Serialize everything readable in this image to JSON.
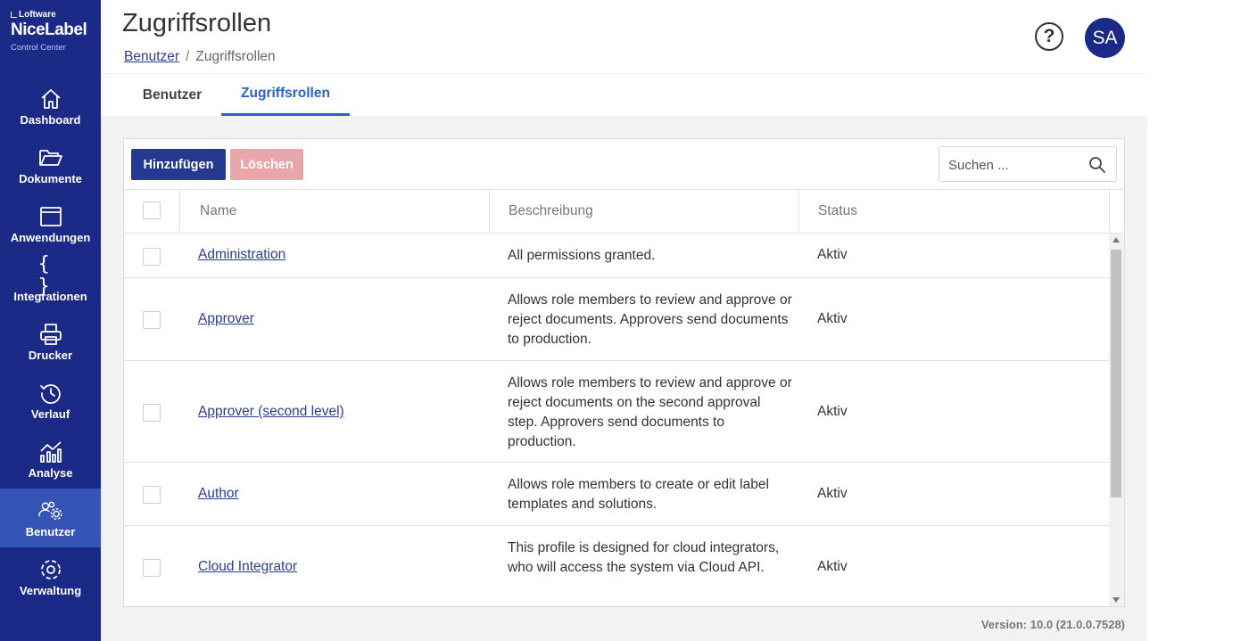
{
  "brand": {
    "company": "Loftware",
    "product": "NiceLabel",
    "subtitle": "Control Center"
  },
  "sidebar": {
    "items": [
      {
        "label": "Dashboard",
        "icon": "home-icon"
      },
      {
        "label": "Dokumente",
        "icon": "folder-icon"
      },
      {
        "label": "Anwendungen",
        "icon": "window-icon"
      },
      {
        "label": "Integrationen",
        "icon": "braces-icon"
      },
      {
        "label": "Drucker",
        "icon": "printer-icon"
      },
      {
        "label": "Verlauf",
        "icon": "history-icon"
      },
      {
        "label": "Analyse",
        "icon": "analytics-icon"
      },
      {
        "label": "Benutzer",
        "icon": "users-gear-icon",
        "active": true
      },
      {
        "label": "Verwaltung",
        "icon": "gear-icon"
      }
    ]
  },
  "header": {
    "title": "Zugriffsrollen",
    "breadcrumb": {
      "parent": "Benutzer",
      "separator": "/",
      "current": "Zugriffsrollen"
    },
    "help_label": "?",
    "avatar_initials": "SA"
  },
  "tabs": [
    {
      "label": "Benutzer",
      "active": false
    },
    {
      "label": "Zugriffsrollen",
      "active": true
    }
  ],
  "toolbar": {
    "add_label": "Hinzufügen",
    "delete_label": "Löschen",
    "search_placeholder": "Suchen ..."
  },
  "table": {
    "columns": [
      "Name",
      "Beschreibung",
      "Status"
    ],
    "rows": [
      {
        "name": "Administration",
        "description": "All permissions granted.",
        "status": "Aktiv"
      },
      {
        "name": "Approver",
        "description": "Allows role members to review and approve or reject documents. Approvers send documents to production.",
        "status": "Aktiv"
      },
      {
        "name": "Approver (second level)",
        "description": "Allows role members to review and approve or reject documents on the second approval step. Approvers send documents to production.",
        "status": "Aktiv"
      },
      {
        "name": "Author",
        "description": "Allows role members to create or edit label templates and solutions.",
        "status": "Aktiv"
      },
      {
        "name": "Cloud Integrator",
        "description": "This profile is designed for cloud integrators, who will access the system via Cloud API.",
        "status": "Aktiv"
      }
    ]
  },
  "footer": {
    "version": "Version: 10.0 (21.0.0.7528)"
  },
  "colors": {
    "sidebar": "#1a2a86",
    "sidebar_active": "#3554b6",
    "primary_button": "#253a8e",
    "danger_disabled": "#e9a6aa",
    "tab_active": "#2a62c9",
    "link": "#2b3d8f"
  }
}
